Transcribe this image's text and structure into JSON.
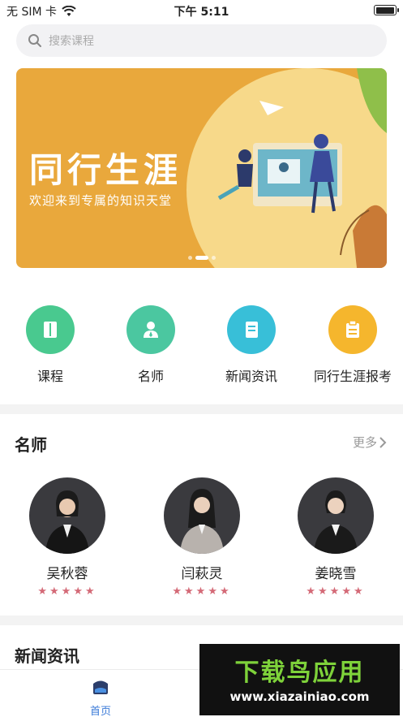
{
  "status_bar": {
    "carrier": "无 SIM 卡",
    "time": "下午 5:11"
  },
  "search": {
    "placeholder": "搜索课程"
  },
  "banner": {
    "title": "同行生涯",
    "subtitle": "欢迎来到专属的知识天堂",
    "slide_count": 3,
    "active_slide": 2
  },
  "categories": [
    {
      "label": "课程",
      "icon": "book-icon",
      "color": "#49c98f"
    },
    {
      "label": "名师",
      "icon": "teacher-icon",
      "color": "#4bc7a0"
    },
    {
      "label": "新闻资讯",
      "icon": "news-icon",
      "color": "#38bfd8"
    },
    {
      "label": "同行生涯报考",
      "icon": "clipboard-icon",
      "color": "#f5b62d"
    }
  ],
  "teachers_section": {
    "title": "名师",
    "more_label": "更多"
  },
  "teachers": [
    {
      "name": "吴秋蓉",
      "stars": "★★★★★",
      "rating": 5
    },
    {
      "name": "闫萩灵",
      "stars": "★★★★★",
      "rating": 5
    },
    {
      "name": "姜晓雪",
      "stars": "★★★★★",
      "rating": 5
    }
  ],
  "news_section": {
    "title": "新闻资讯"
  },
  "tabbar": {
    "home_label": "首页"
  },
  "watermark": {
    "brand": "下载鸟应用",
    "url": "www.xiazainiao.com"
  },
  "colors": {
    "banner_bg": "#e9a83c",
    "accent_blue": "#3b7bd8",
    "star": "#d46a77"
  }
}
